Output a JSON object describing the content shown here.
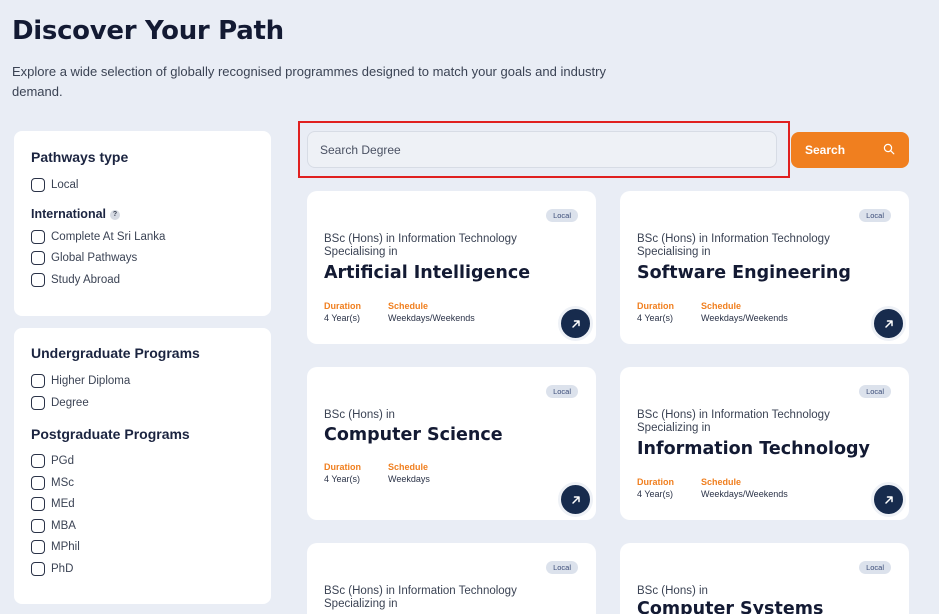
{
  "header": {
    "title": "Discover Your Path",
    "subtitle": "Explore a wide selection of globally recognised programmes designed to match your goals and industry demand."
  },
  "filters": {
    "pathways_title": "Pathways type",
    "local_label": "Local",
    "international_title": "International",
    "help_glyph": "?",
    "international_options": [
      "Complete At Sri Lanka",
      "Global Pathways",
      "Study Abroad"
    ],
    "undergrad_title": "Undergraduate Programs",
    "undergrad_options": [
      "Higher Diploma",
      "Degree"
    ],
    "postgrad_title": "Postgraduate Programs",
    "postgrad_options": [
      "PGd",
      "MSc",
      "MEd",
      "MBA",
      "MPhil",
      "PhD"
    ]
  },
  "search": {
    "placeholder": "Search Degree",
    "button_label": "Search"
  },
  "labels": {
    "duration": "Duration",
    "schedule": "Schedule"
  },
  "cards": [
    {
      "badge": "Local",
      "prefix1": "BSc (Hons) in Information Technology",
      "prefix2": "Specialising in",
      "title": "Artificial Intelligence",
      "duration": "4 Year(s)",
      "schedule": "Weekdays/Weekends"
    },
    {
      "badge": "Local",
      "prefix1": "BSc (Hons) in Information Technology",
      "prefix2": "Specialising in",
      "title": "Software Engineering",
      "duration": "4 Year(s)",
      "schedule": "Weekdays/Weekends"
    },
    {
      "badge": "Local",
      "prefix1": "BSc (Hons) in",
      "prefix2": "",
      "title": "Computer Science",
      "duration": "4 Year(s)",
      "schedule": "Weekdays"
    },
    {
      "badge": "Local",
      "prefix1": "BSc (Hons) in Information Technology",
      "prefix2": "Specializing in",
      "title": "Information Technology",
      "duration": "4 Year(s)",
      "schedule": "Weekdays/Weekends"
    },
    {
      "badge": "Local",
      "prefix1": "BSc (Hons) in Information Technology",
      "prefix2": "Specializing in",
      "title": "",
      "duration": "",
      "schedule": ""
    },
    {
      "badge": "Local",
      "prefix1": "BSc (Hons) in",
      "prefix2": "",
      "title": "Computer Systems",
      "duration": "",
      "schedule": ""
    }
  ],
  "colors": {
    "accent": "#f07f1f",
    "navy": "#172b4d",
    "background": "#e9edf5",
    "highlight": "#e02020"
  }
}
